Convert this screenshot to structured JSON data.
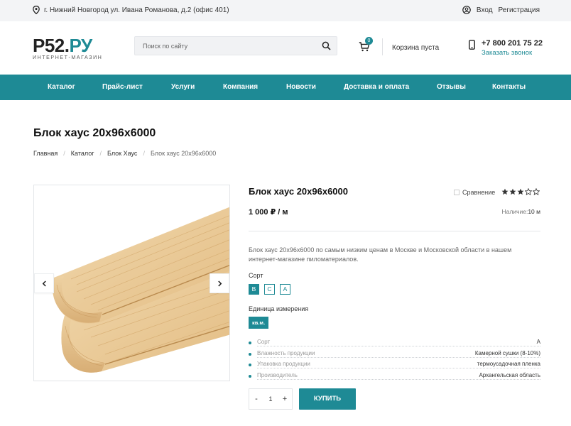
{
  "topbar": {
    "address": "г. Нижний Новгород ул. Ивана Романова, д.2 (офис 401)",
    "login": "Вход",
    "register": "Регистрация"
  },
  "header": {
    "logo_main": "Р52.",
    "logo_accent": "РУ",
    "logo_sub": "ИНТЕРНЕТ-МАГАЗИН",
    "search_placeholder": "Поиск по сайту",
    "cart_count": "0",
    "cart_text": "Корзина пуста",
    "phone": "+7 800 201 75 22",
    "callback": "Заказать звонок"
  },
  "nav": {
    "items": [
      "Каталог",
      "Прайс-лист",
      "Услуги",
      "Компания",
      "Новости",
      "Доставка и оплата",
      "Отзывы",
      "Контакты"
    ]
  },
  "page": {
    "title": "Блок хаус 20х96х6000",
    "breadcrumb": [
      "Главная",
      "Каталог",
      "Блок Хаус",
      "Блок хаус 20х96х6000"
    ]
  },
  "product": {
    "title": "Блок хаус 20х96х6000",
    "compare_label": "Сравнение",
    "rating": 3,
    "rating_max": 5,
    "price": "1 000 ₽ / м",
    "stock_label": "Наличие:",
    "stock_value": "10 м",
    "description": "Блок хаус 20х96х6000 по самым низким ценам в Москве и Московской области в нашем интернет-магазине пиломатериалов.",
    "grade_label": "Сорт",
    "grades": [
      "В",
      "С",
      "А"
    ],
    "grade_selected": "В",
    "unit_label": "Единица измерения",
    "unit_value": "кв.м.",
    "properties": [
      {
        "key": "Сорт",
        "value": "А"
      },
      {
        "key": "Влажность продукции",
        "value": "Камерной сушки (8-10%)"
      },
      {
        "key": "Упаковка продукции",
        "value": "термоусадочная пленка"
      },
      {
        "key": "Производитель",
        "value": "Архангельская область"
      }
    ],
    "quantity": "1",
    "minus": "-",
    "plus": "+",
    "buy_label": "КУПИТЬ"
  },
  "colors": {
    "accent": "#1e8a95",
    "topbar_bg": "#f3f4f6"
  }
}
